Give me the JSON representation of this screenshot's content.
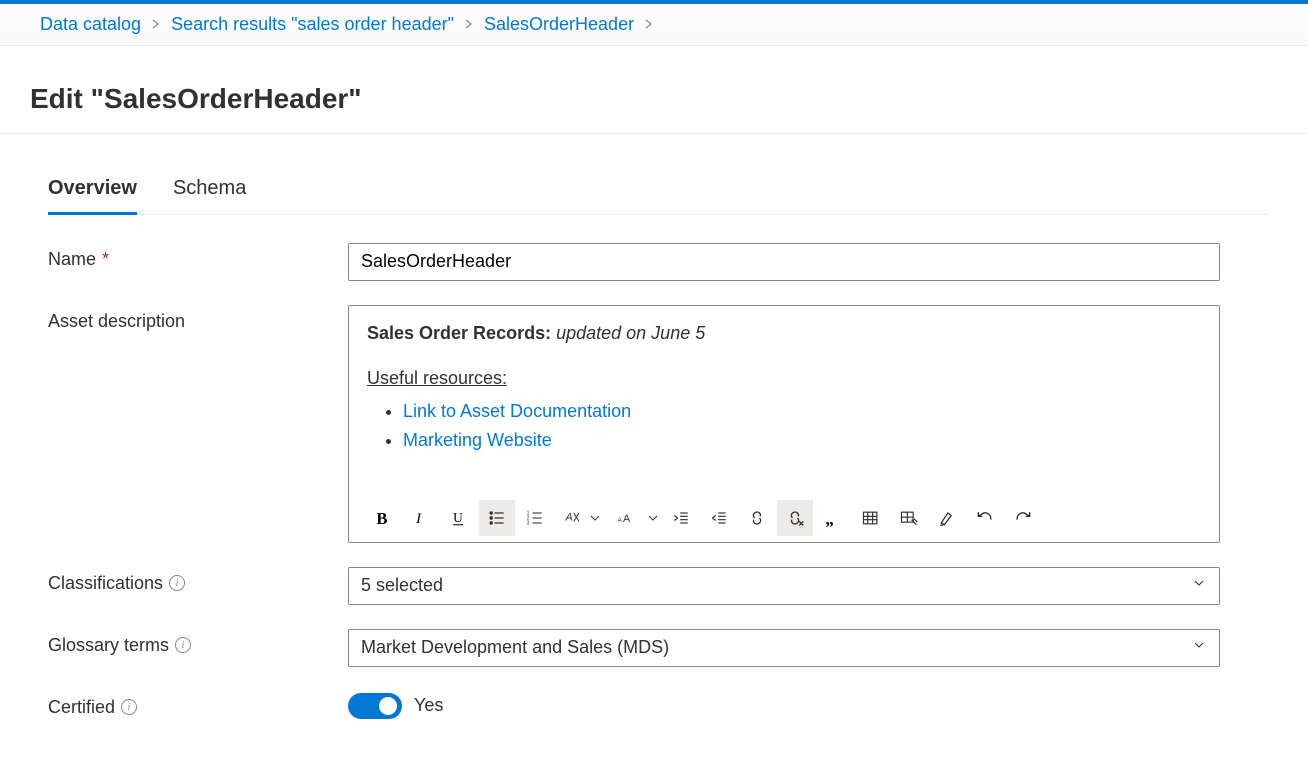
{
  "breadcrumb": {
    "items": [
      "Data catalog",
      "Search results \"sales order header\"",
      "SalesOrderHeader"
    ]
  },
  "page": {
    "title": "Edit \"SalesOrderHeader\""
  },
  "tabs": {
    "overview": "Overview",
    "schema": "Schema"
  },
  "labels": {
    "name": "Name",
    "asset_description": "Asset description",
    "classifications": "Classifications",
    "glossary_terms": "Glossary terms",
    "certified": "Certified"
  },
  "form": {
    "name_value": "SalesOrderHeader",
    "description": {
      "bold_prefix": "Sales Order Records:",
      "italic_suffix": "updated on June 5",
      "resources_heading": "Useful resources:",
      "links": [
        "Link to Asset Documentation",
        "Marketing Website"
      ]
    },
    "classifications_value": "5 selected",
    "glossary_value": "Market Development and Sales (MDS)",
    "certified_on": true,
    "certified_label": "Yes"
  },
  "toolbar": {
    "buttons": [
      "bold",
      "italic",
      "underline",
      "bulleted-list",
      "numbered-list",
      "clear-formatting",
      "font-size",
      "decrease-indent",
      "increase-indent",
      "insert-link",
      "remove-link",
      "blockquote",
      "insert-table",
      "edit-table",
      "highlight",
      "undo",
      "redo"
    ]
  }
}
